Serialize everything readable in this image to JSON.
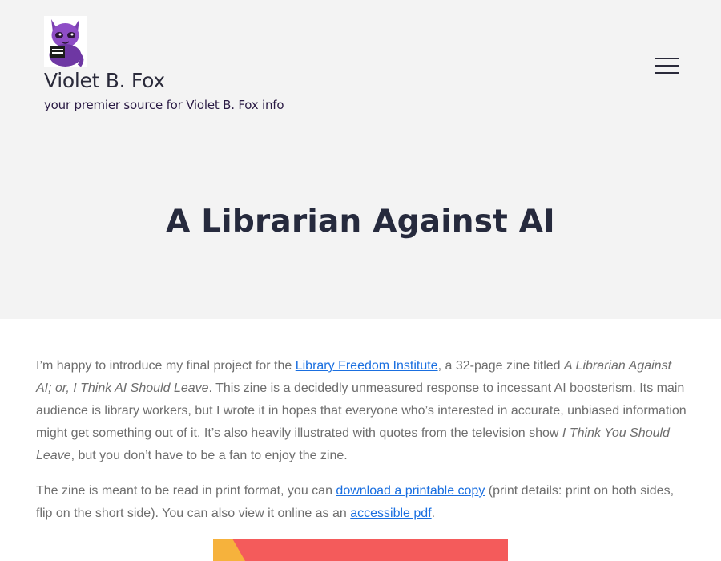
{
  "site": {
    "title": "Violet B. Fox",
    "tagline": "your premier source for Violet B. Fox info",
    "logo_icon": "purple-fox-with-book-icon"
  },
  "menu": {
    "icon": "hamburger-menu-icon"
  },
  "page": {
    "title": "A Librarian Against AI"
  },
  "paragraph1": {
    "t1": "I’m happy to introduce my final project for the ",
    "link1": "Library Freedom Institute",
    "t2": ", a 32-page zine titled ",
    "em1": "A Librarian Against AI; or, I Think AI Should Leave",
    "t3": ". This zine is a decidedly unmeasured response to incessant AI boosterism. Its main audience is library workers, but I wrote it in hopes that everyone who’s interested in accurate, unbiased information might get something out of it. It’s also heavily illustrated with quotes from the television show ",
    "em2": "I Think You Should Leave",
    "t4": ", but you don’t have to be a fan to enjoy the zine."
  },
  "paragraph2": {
    "t1": "The zine is meant to be read in print format, you can ",
    "link1": "download a printable copy",
    "t2": " (print details: print on both sides, flip on the short side). You can also view it online as an ",
    "link2": "accessible pdf",
    "t3": "."
  },
  "colors": {
    "header_bg": "#f3f3f3",
    "link": "#1a6fe0",
    "title": "#262a3d",
    "cover_red": "#f45b5b",
    "cover_yellow": "#f6b23c"
  }
}
